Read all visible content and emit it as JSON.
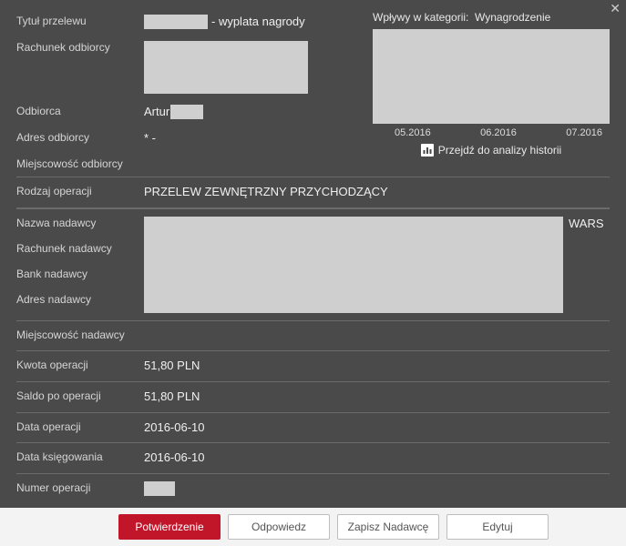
{
  "header": {
    "title_label": "Tytuł przelewu",
    "title_suffix": "- wyplata nagrody"
  },
  "recipient": {
    "account_label": "Rachunek odbiorcy",
    "name_label": "Odbiorca",
    "name_value": "Artur",
    "address_label": "Adres odbiorcy",
    "address_value": "*  -",
    "city_label": "Miejscowość odbiorcy"
  },
  "operation": {
    "type_label": "Rodzaj operacji",
    "type_value": "PRZELEW ZEWNĘTRZNY PRZYCHODZĄCY"
  },
  "sender": {
    "name_label": "Nazwa nadawcy",
    "name_suffix": "WARS",
    "account_label": "Rachunek nadawcy",
    "bank_label": "Bank nadawcy",
    "address_label": "Adres nadawcy",
    "city_label": "Miejscowość nadawcy"
  },
  "amounts": {
    "op_amount_label": "Kwota operacji",
    "op_amount_value": "51,80 PLN",
    "balance_label": "Saldo po operacji",
    "balance_value": "51,80 PLN",
    "op_date_label": "Data operacji",
    "op_date_value": "2016-06-10",
    "post_date_label": "Data księgowania",
    "post_date_value": "2016-06-10",
    "op_number_label": "Numer operacji"
  },
  "category": {
    "title_prefix": "Wpływy w kategorii:",
    "title_value": "Wynagrodzenie",
    "months": [
      "05.2016",
      "06.2016",
      "07.2016"
    ],
    "analysis_link": "Przejdź do analizy historii"
  },
  "buttons": {
    "confirm": "Potwierdzenie",
    "reply": "Odpowiedz",
    "save_sender": "Zapisz Nadawcę",
    "edit": "Edytuj"
  },
  "chart_data": {
    "type": "bar",
    "categories": [
      "05.2016",
      "06.2016",
      "07.2016"
    ],
    "values": [
      null,
      null,
      null
    ],
    "title": "Wpływy w kategorii: Wynagrodzenie",
    "xlabel": "",
    "ylabel": "",
    "ylim": [
      0,
      100
    ],
    "note": "chart body redacted in source image"
  }
}
